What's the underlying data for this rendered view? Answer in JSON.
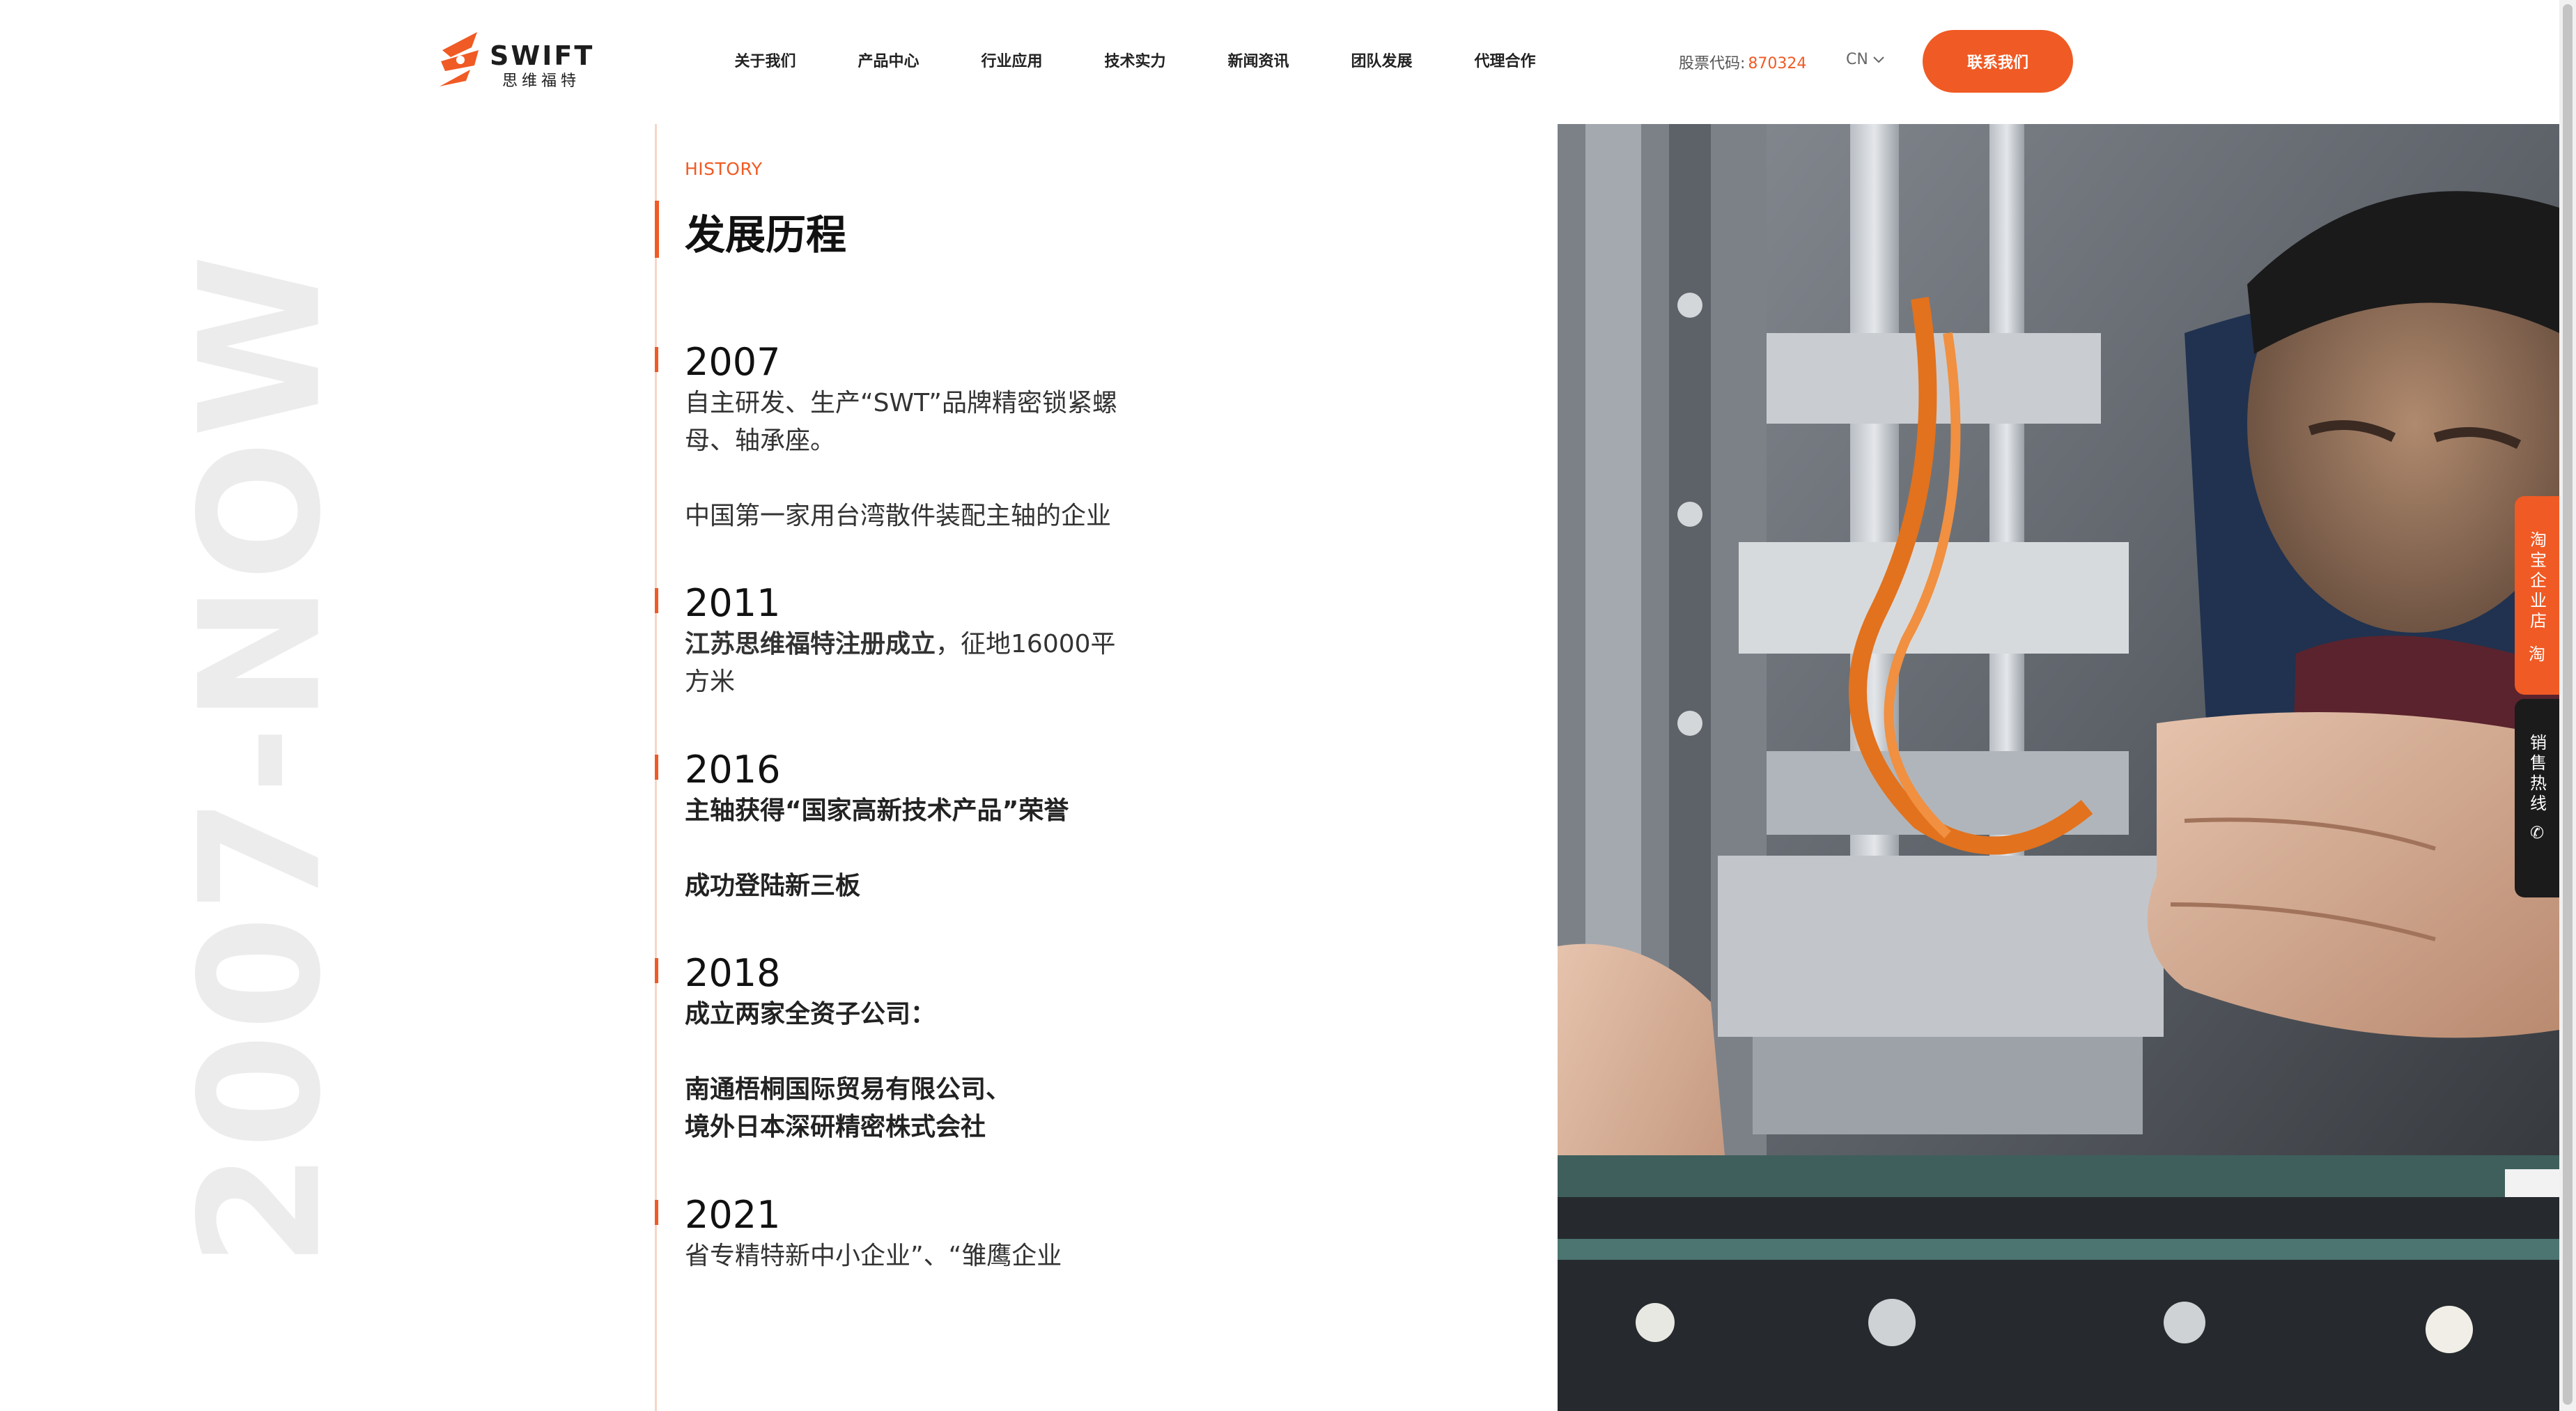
{
  "header": {
    "logo_text": "SWIFT",
    "logo_sub": "思维福特",
    "nav": [
      "关于我们",
      "产品中心",
      "行业应用",
      "技术实力",
      "新闻资讯",
      "团队发展",
      "代理合作"
    ],
    "stock_label": "股票代码:",
    "stock_code": "870324",
    "lang": "CN",
    "contact_button": "联系我们"
  },
  "side": {
    "vertical_label": "2007-NOW"
  },
  "history": {
    "label": "HISTORY",
    "title": "发展历程",
    "entries": [
      {
        "year": "2007",
        "lines": [
          "自主研发、生产“SWT”品牌精密锁紧螺",
          "母、轴承座。",
          "",
          "中国第一家用台湾散件装配主轴的企业"
        ]
      },
      {
        "year": "2011",
        "bold_part": "江苏思维福特注册成立",
        "rest_part": "，征地16000平",
        "line2": "方米"
      },
      {
        "year": "2016",
        "lines": [
          "主轴获得“国家高新技术产品”荣誉",
          "",
          "成功登陆新三板"
        ]
      },
      {
        "year": "2018",
        "lines": [
          "成立两家全资子公司：",
          "",
          "南通梧桐国际贸易有限公司、",
          "境外日本深研精密株式会社"
        ]
      },
      {
        "year": "2021",
        "lines": [
          "省专精特新中小企业”、“雏鹰企业"
        ]
      }
    ]
  },
  "float": {
    "taobao": "淘宝企业店",
    "taobao_icon": "淘",
    "hotline": "销售热线",
    "hotline_icon": "✆"
  },
  "colors": {
    "accent": "#f05a24",
    "dark": "#1b1b1b"
  }
}
